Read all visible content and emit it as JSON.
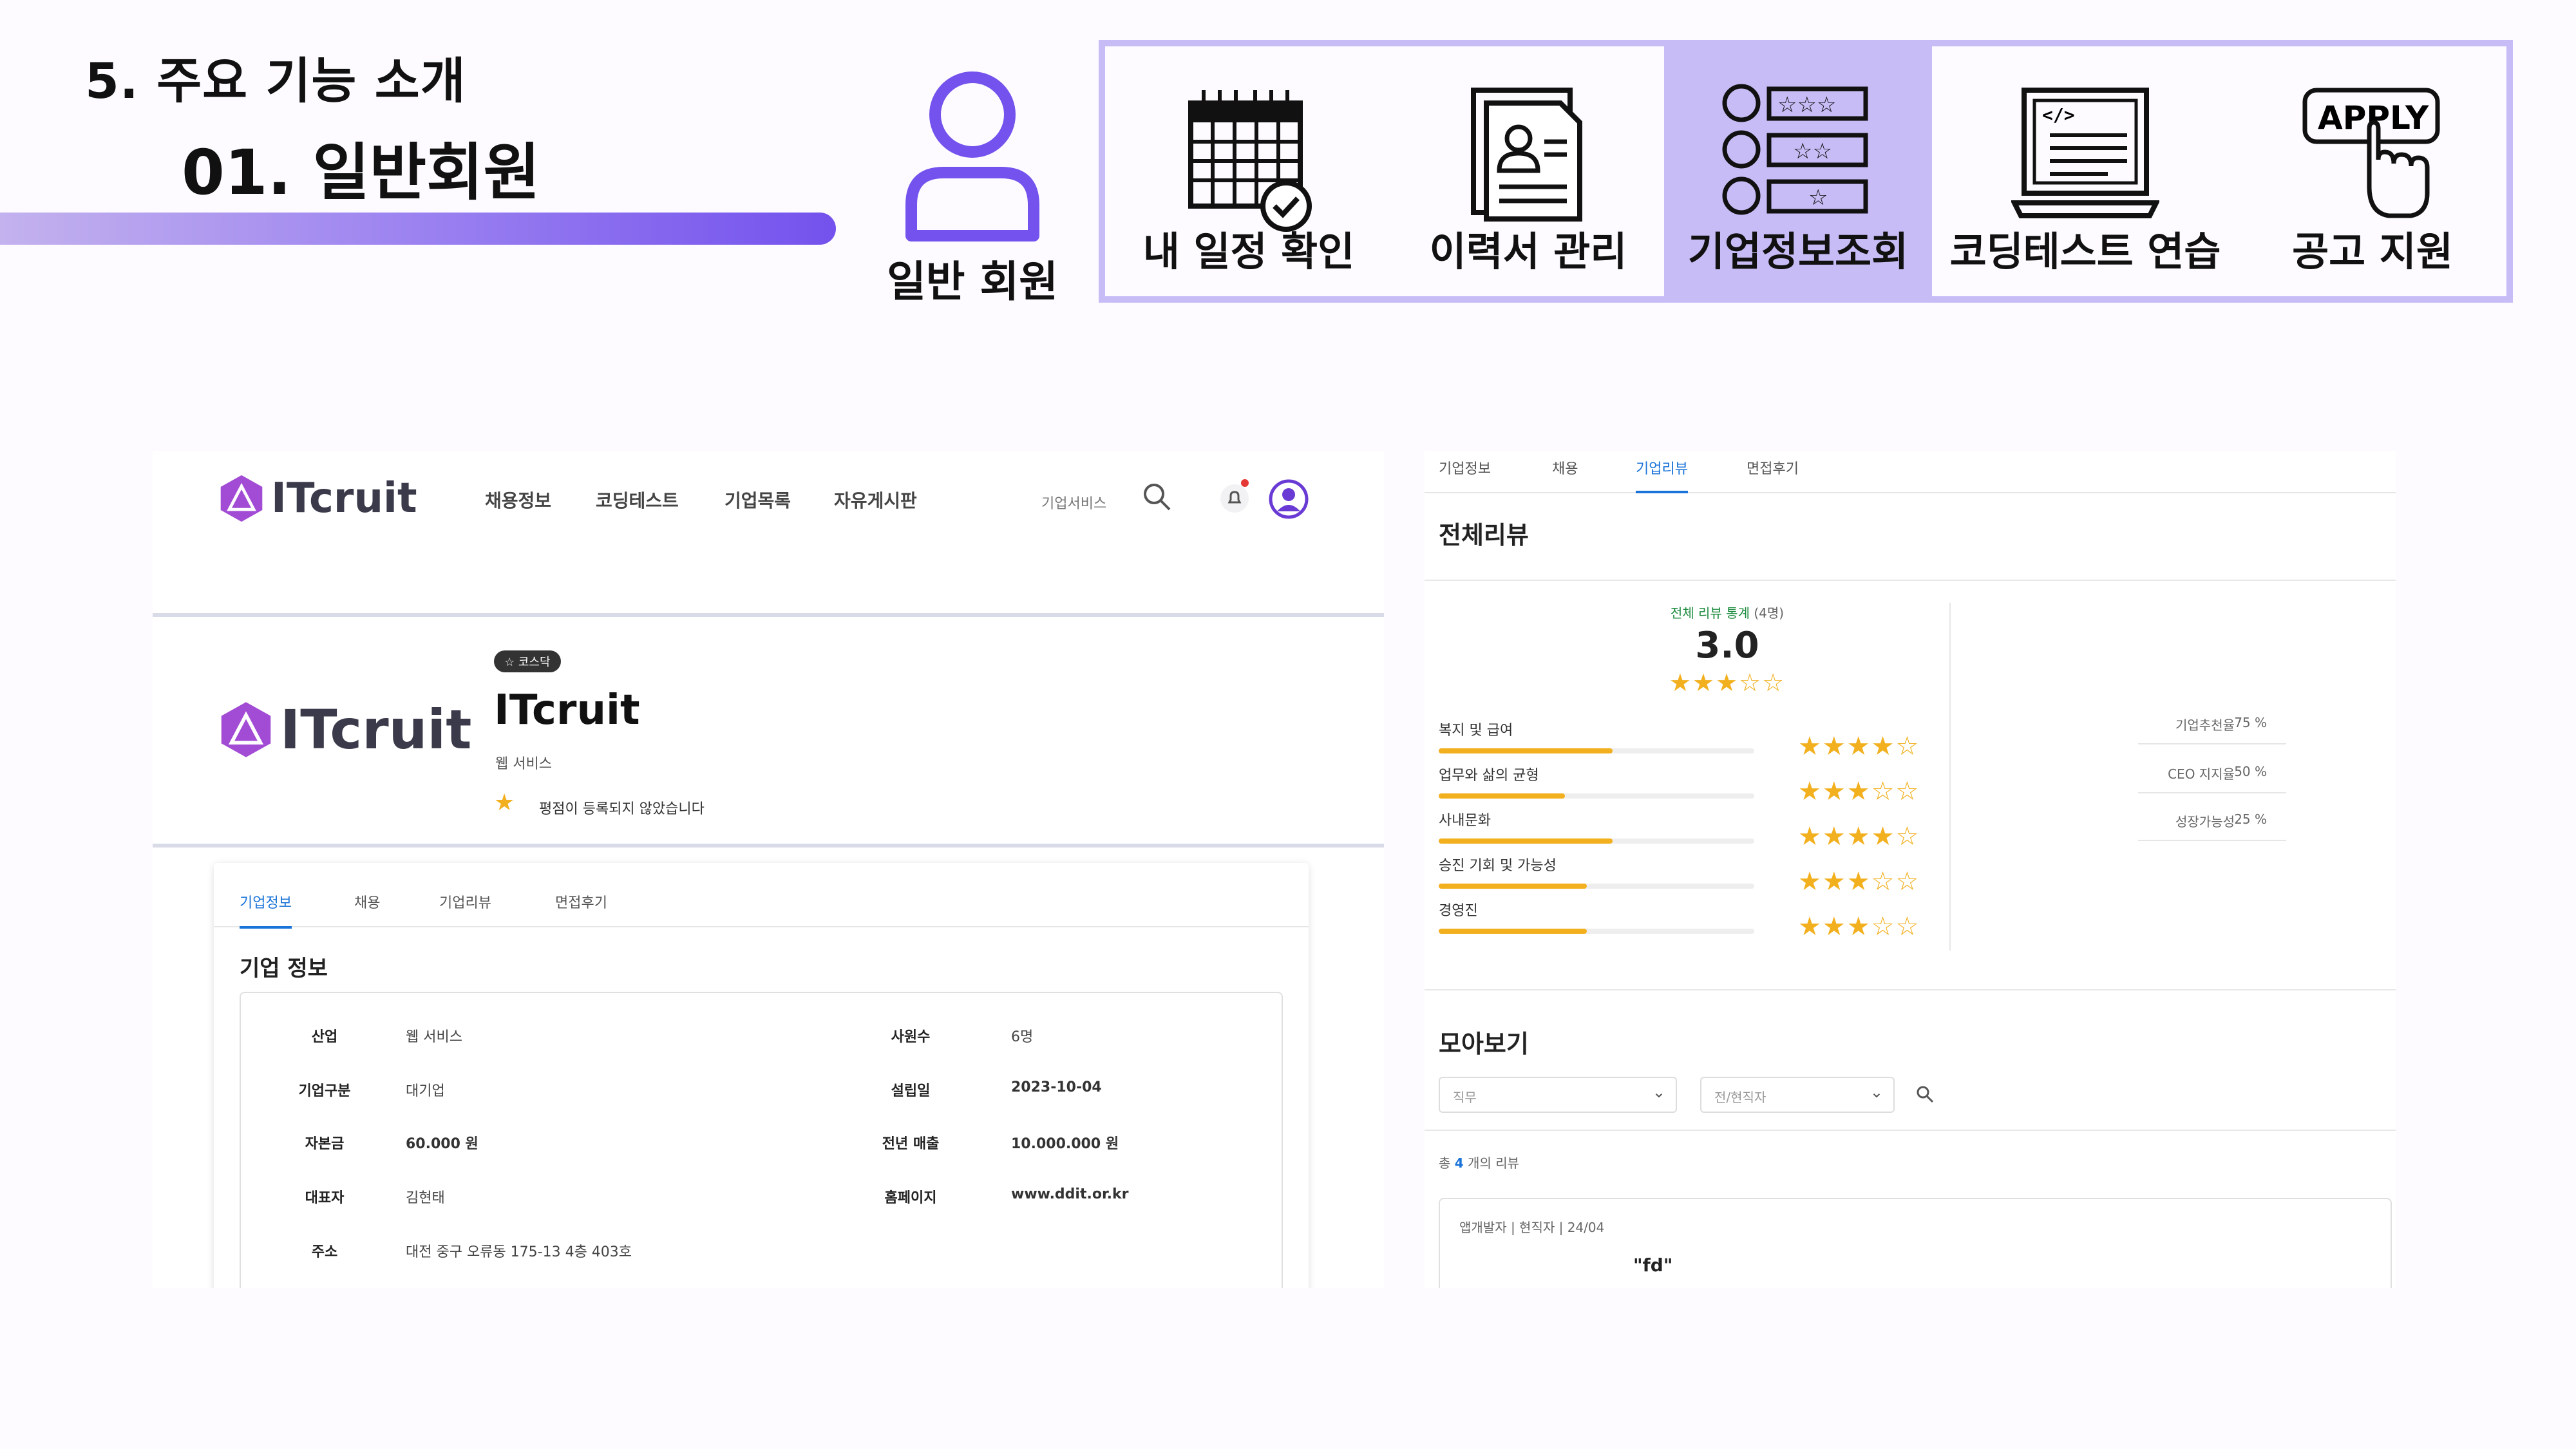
{
  "header": {
    "section_title": "5. 주요 기능 소개",
    "member_title": "01. 일반회원",
    "member_label": "일반 회원"
  },
  "features": [
    {
      "label": "내 일정 확인",
      "icon": "calendar-check-icon",
      "active": false
    },
    {
      "label": "이력서 관리",
      "icon": "resume-icon",
      "active": false
    },
    {
      "label": "기업정보조회",
      "icon": "company-rating-icon",
      "active": true
    },
    {
      "label": "코딩테스트 연습",
      "icon": "code-laptop-icon",
      "active": false
    },
    {
      "label": "공고 지원",
      "icon": "apply-click-icon",
      "active": false
    }
  ],
  "colors": {
    "accent": "#7352ed",
    "feature_border": "#c8bcf6",
    "tab_active": "#1a73d9",
    "star": "#f2b01e"
  },
  "left": {
    "logo_text": "ITcruit",
    "nav": [
      "채용정보",
      "코딩테스트",
      "기업목록",
      "자유게시판"
    ],
    "nav_service": "기업서비스",
    "badge": "☆ 코스닥",
    "company_name": "ITcruit",
    "company_category": "웹 서비스",
    "company_review": "평점이 등록되지 않았습니다",
    "tabs": [
      "기업정보",
      "채용",
      "기업리뷰",
      "면접후기"
    ],
    "card_title": "기업 정보",
    "info": {
      "industry_label": "산업",
      "industry": "웹 서비스",
      "employees_label": "사원수",
      "employees": "6명",
      "type_label": "기업구분",
      "type": "대기업",
      "founded_label": "설립일",
      "founded": "2023-10-04",
      "capital_label": "자본금",
      "capital": "60.000 원",
      "revenue_label": "전년 매출",
      "revenue": "10.000.000 원",
      "ceo_label": "대표자",
      "ceo": "김현태",
      "homepage_label": "홈페이지",
      "homepage": "www.ddit.or.kr",
      "address_label": "주소",
      "address": "대전 중구 오류동 175-13 4층 403호"
    }
  },
  "right": {
    "tabs": [
      "기업정보",
      "채용",
      "기업리뷰",
      "면접후기"
    ],
    "title": "전체리뷰",
    "stat_label": "전체 리뷰 통계",
    "stat_count": "(4명)",
    "score": "3.0",
    "score_stars": "★★★☆☆",
    "categories": [
      {
        "label": "복지 및 급여",
        "fill": 0.55,
        "stars": "★★★★☆"
      },
      {
        "label": "업무와 삶의 균형",
        "fill": 0.4,
        "stars": "★★★☆☆"
      },
      {
        "label": "사내문화",
        "fill": 0.55,
        "stars": "★★★★☆"
      },
      {
        "label": "승진 기회 및 가능성",
        "fill": 0.47,
        "stars": "★★★☆☆"
      },
      {
        "label": "경영진",
        "fill": 0.47,
        "stars": "★★★☆☆"
      }
    ],
    "percentages": [
      {
        "label": "기업추천율",
        "value": "75 %"
      },
      {
        "label": "CEO 지지율",
        "value": "50 %"
      },
      {
        "label": "성장가능성",
        "value": "25 %"
      }
    ],
    "gallery_title": "모아보기",
    "filter_job_placeholder": "직무",
    "filter_status_placeholder": "전/현직자",
    "count_prefix": "총",
    "count": "4",
    "count_suffix": "개의 리뷰",
    "review_meta": "앱개발자  |  현직자  |  24/04",
    "review_quote": "\"fd\""
  }
}
